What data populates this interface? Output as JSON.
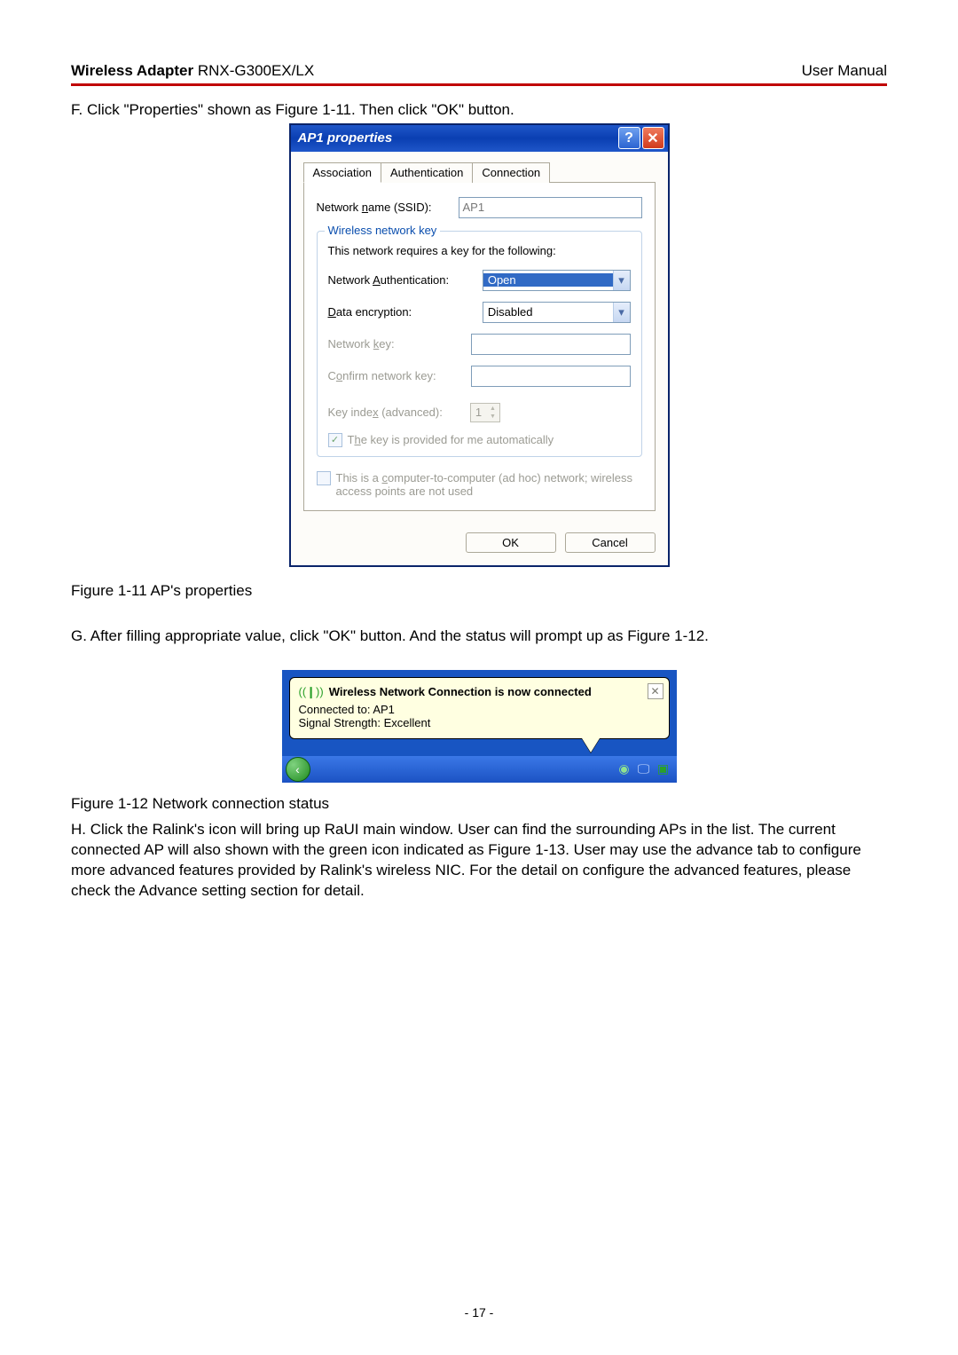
{
  "header": {
    "product_bold": "Wireless Adapter",
    "product_model": " RNX-G300EX/LX",
    "right": "User Manual"
  },
  "text": {
    "stepF": "F. Click \"Properties\" shown as Figure 1-11. Then click \"OK\" button.",
    "caption1": "Figure 1-11 AP's properties",
    "stepG": "G. After filling appropriate value, click \"OK\" button. And the status will prompt up as Figure 1-12.",
    "caption2": "Figure 1-12 Network connection status",
    "stepH": "H. Click the Ralink's icon will bring up RaUI main window. User can find the surrounding APs in the list. The current connected AP will also shown with the green icon indicated as Figure 1-13. User may use the advance tab to configure more advanced features provided by Ralink's wireless NIC. For the detail on configure the advanced features, please check the Advance setting section for detail.",
    "pagefoot": "- 17 -"
  },
  "dialog": {
    "title": "AP1 properties",
    "tabs": {
      "t1": "Association",
      "t2": "Authentication",
      "t3": "Connection"
    },
    "ssid_label_pre": "Network ",
    "ssid_label_u": "n",
    "ssid_label_post": "ame (SSID):",
    "ssid_value": "AP1",
    "group_legend": "Wireless network key",
    "requires": "This network requires a key for the following:",
    "auth_label_pre": "Network ",
    "auth_label_u": "A",
    "auth_label_post": "uthentication:",
    "auth_value": "Open",
    "enc_label_u": "D",
    "enc_label_post": "ata encryption:",
    "enc_value": "Disabled",
    "key_label_pre": "Network ",
    "key_label_u": "k",
    "key_label_post": "ey:",
    "confirm_label_pre": "C",
    "confirm_label_u": "o",
    "confirm_label_post": "nfirm network key:",
    "index_label_pre": "Key inde",
    "index_label_u": "x",
    "index_label_post": " (advanced):",
    "index_value": "1",
    "auto_key_pre": "T",
    "auto_key_u": "h",
    "auto_key_post": "e key is provided for me automatically",
    "adhoc_pre": "This is a ",
    "adhoc_u": "c",
    "adhoc_post": "omputer-to-computer (ad hoc) network; wireless access points are not used",
    "ok": "OK",
    "cancel": "Cancel"
  },
  "balloon": {
    "title": "Wireless Network Connection is now connected",
    "line1": "Connected to: AP1",
    "line2": "Signal Strength: Excellent"
  }
}
